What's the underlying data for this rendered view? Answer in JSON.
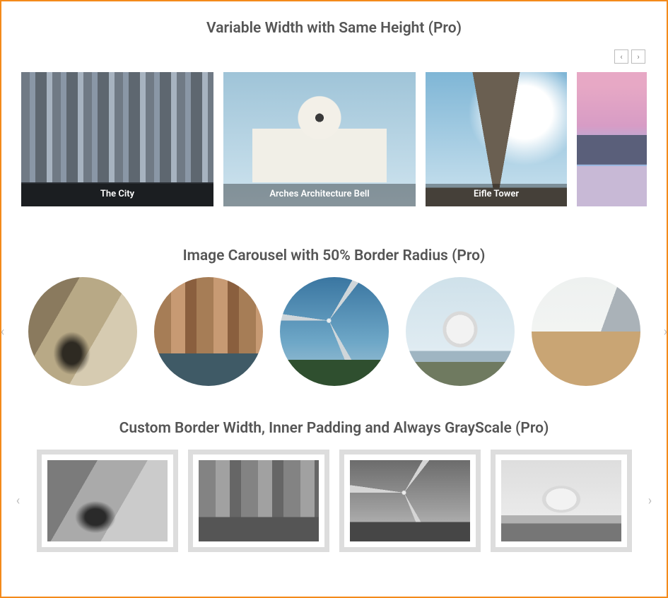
{
  "section1": {
    "title": "Variable Width with Same Height (Pro)",
    "items": [
      {
        "caption": "The City"
      },
      {
        "caption": "Arches Architecture Bell"
      },
      {
        "caption": "Eifle Tower"
      },
      {
        "caption": ""
      }
    ]
  },
  "section2": {
    "title": "Image Carousel with 50% Border Radius (Pro)"
  },
  "section3": {
    "title": "Custom Border Width, Inner Padding and Always GrayScale (Pro)"
  },
  "icons": {
    "chevron_left": "‹",
    "chevron_right": "›"
  }
}
